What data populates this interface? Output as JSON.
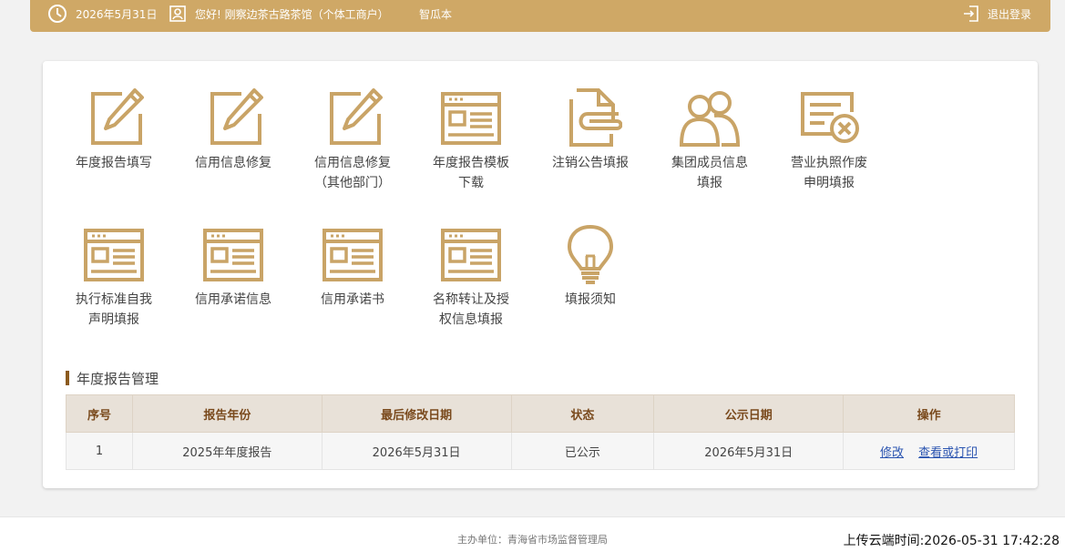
{
  "header": {
    "date": "2026年5月31日",
    "greeting": "您好! 刚察边茶古路茶馆（个体工商户）",
    "account_name": "智瓜本",
    "logout_label": "退出登录",
    "bg_color": "#cfa866"
  },
  "tiles": [
    {
      "label": "年度报告填写",
      "icon": "edit-icon"
    },
    {
      "label": "信用信息修复",
      "icon": "edit-icon"
    },
    {
      "label": "信用信息修复（其他部门）",
      "icon": "edit-icon"
    },
    {
      "label": "年度报告模板下载",
      "icon": "form-icon"
    },
    {
      "label": "注销公告填报",
      "icon": "paper-clip-icon"
    },
    {
      "label": "集团成员信息填报",
      "icon": "users-icon"
    },
    {
      "label": "营业执照作废申明填报",
      "icon": "license-cancel-icon"
    },
    {
      "label": "执行标准自我声明填报",
      "icon": "form-icon"
    },
    {
      "label": "信用承诺信息",
      "icon": "form-icon"
    },
    {
      "label": "信用承诺书",
      "icon": "form-icon"
    },
    {
      "label": "名称转让及授权信息填报",
      "icon": "form-icon"
    },
    {
      "label": "填报须知",
      "icon": "lightbulb-icon"
    }
  ],
  "report_section": {
    "title": "年度报告管理",
    "columns": [
      "序号",
      "报告年份",
      "最后修改日期",
      "状态",
      "公示日期",
      "操作"
    ],
    "rows": [
      {
        "index": "1",
        "year": "2025年年度报告",
        "modified": "2026年5月31日",
        "status": "已公示",
        "published": "2026年5月31日",
        "actions": [
          "修改",
          "查看或打印"
        ]
      }
    ]
  },
  "footer": {
    "host": "主办单位：青海省市场监督管理局"
  },
  "upload_time": "上传云端时间:2026-05-31 17:42:28",
  "colors": {
    "accent": "#cfa866",
    "icon": "#c9a467",
    "link": "#2a54b0",
    "table_header_bg": "#e8e1d8",
    "table_header_text": "#7a4a1d"
  }
}
